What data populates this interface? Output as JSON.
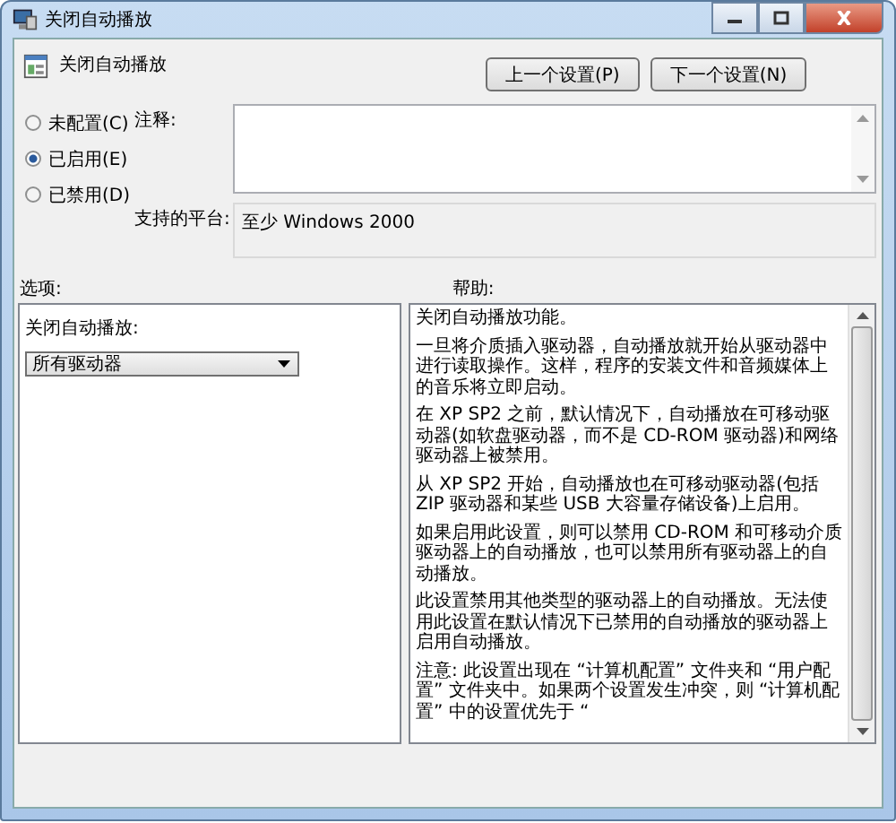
{
  "window": {
    "title": "关闭自动播放"
  },
  "policy": {
    "title": "关闭自动播放"
  },
  "nav_buttons": [
    "上一个设置(P)",
    "下一个设置(N)"
  ],
  "states": [
    {
      "label": "未配置(C)",
      "selected": false
    },
    {
      "label": "已启用(E)",
      "selected": true
    },
    {
      "label": "已禁用(D)",
      "selected": false
    }
  ],
  "comment": {
    "label": "注释:"
  },
  "platform": {
    "label": "支持的平台:",
    "value": "至少 Windows 2000"
  },
  "options": {
    "label": "选项:",
    "field_label": "关闭自动播放:",
    "dropdown": {
      "value": "所有驱动器"
    }
  },
  "help": {
    "label": "帮助:",
    "paragraphs": [
      "关闭自动播放功能。",
      "一旦将介质插入驱动器，自动播放就开始从驱动器中进行读取操作。这样，程序的安装文件和音频媒体上的音乐将立即启动。",
      "在 XP SP2 之前，默认情况下，自动播放在可移动驱动器(如软盘驱动器，而不是 CD-ROM 驱动器)和网络驱动器上被禁用。",
      "从 XP SP2 开始，自动播放也在可移动驱动器(包括 ZIP 驱动器和某些 USB 大容量存储设备)上启用。",
      "如果启用此设置，则可以禁用 CD-ROM 和可移动介质驱动器上的自动播放，也可以禁用所有驱动器上的自动播放。",
      "此设置禁用其他类型的驱动器上的自动播放。无法使用此设置在默认情况下已禁用的自动播放的驱动器上启用自动播放。",
      "注意: 此设置出现在 “计算机配置” 文件夹和 “用户配置” 文件夹中。如果两个设置发生冲突，则 “计算机配置” 中的设置优先于 “"
    ]
  }
}
